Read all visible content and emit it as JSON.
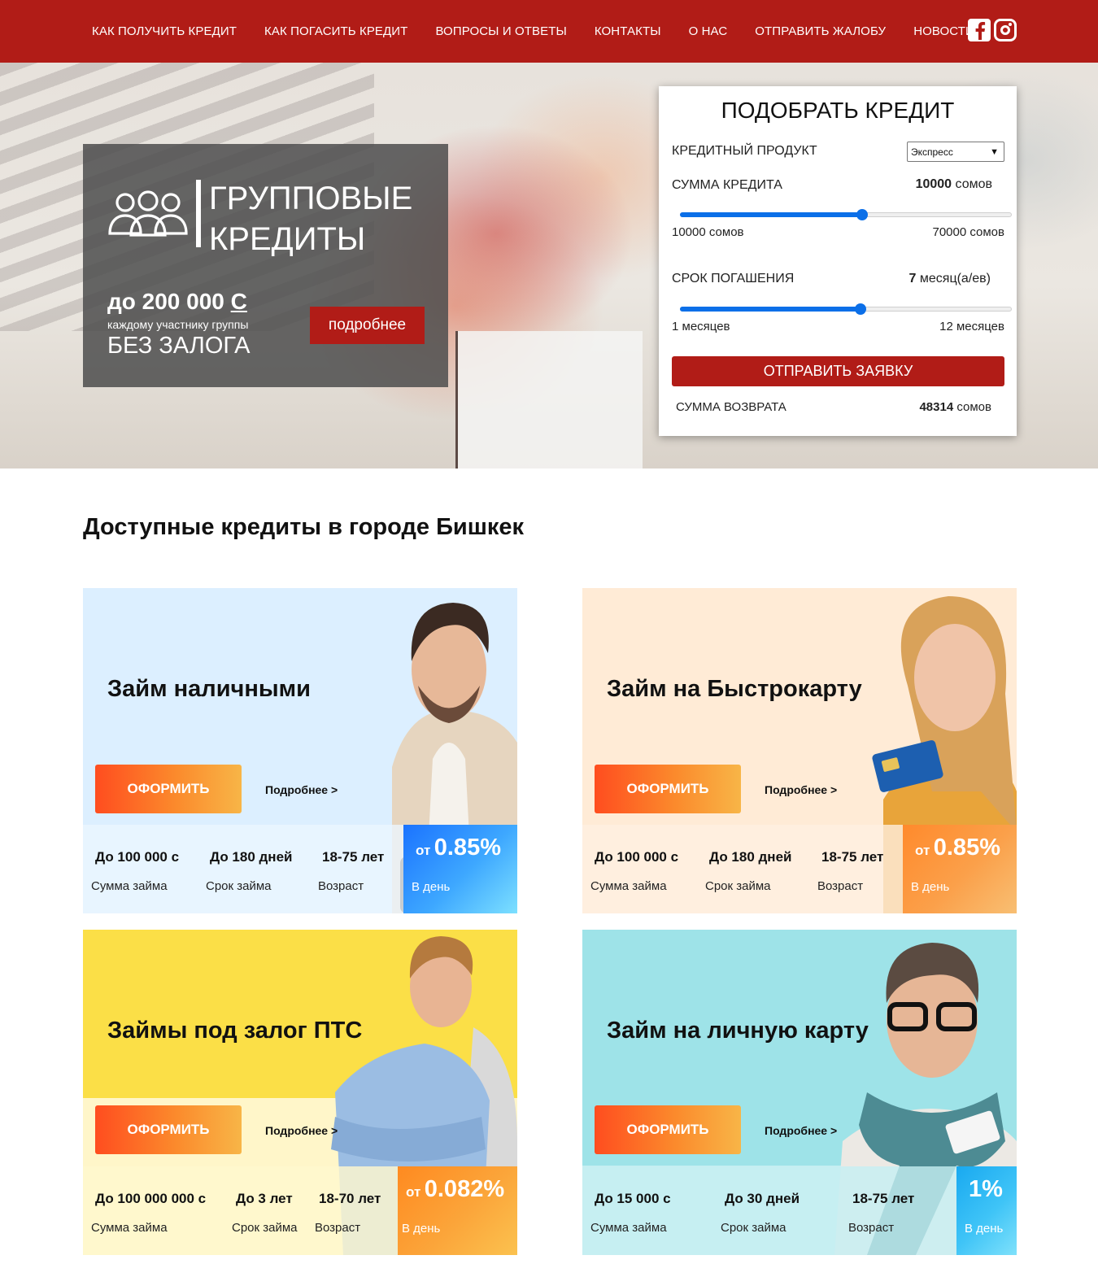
{
  "nav": {
    "items": [
      "КАК ПОЛУЧИТЬ КРЕДИТ",
      "КАК ПОГАСИТЬ КРЕДИТ",
      "ВОПРОСЫ И ОТВЕТЫ",
      "КОНТАКТЫ",
      "О НАС",
      "ОТПРАВИТЬ ЖАЛОБУ",
      "НОВОСТИ"
    ],
    "icons": [
      "facebook-icon",
      "instagram-icon"
    ]
  },
  "promo": {
    "title": "ГРУППОВЫЕ\nКРЕДИТЫ",
    "amount": "до 200 000",
    "currency": "С",
    "subtitle": "каждому участнику группы",
    "no_collateral": "БЕЗ ЗАЛОГА",
    "button": "подробнее"
  },
  "calc": {
    "title": "ПОДОБРАТЬ КРЕДИТ",
    "product_label": "КРЕДИТНЫЙ ПРОДУКТ",
    "product_value": "Экспресс",
    "amount_label": "СУММА КРЕДИТА",
    "amount_value": "10000",
    "amount_unit": "сомов",
    "amount_min": "10000 сомов",
    "amount_max": "70000 сомов",
    "amount_slider_fraction": 0.55,
    "term_label": "СРОК ПОГАШЕНИЯ",
    "term_value": "7",
    "term_unit": "месяц(а/ев)",
    "term_min": "1 месяцев",
    "term_max": "12 месяцев",
    "term_slider_fraction": 0.545,
    "submit": "ОТПРАВИТЬ ЗАЯВКУ",
    "return_label": "СУММА ВОЗВРАТА",
    "return_value": "48314",
    "return_unit": "сомов"
  },
  "section": {
    "title": "Доступные кредиты в городе Бишкек"
  },
  "cards": [
    {
      "title": "Займ наличными",
      "apply": "ОФОРМИТЬ",
      "more": "Подробнее >",
      "stats": [
        {
          "value": "До 100 000 с",
          "label": "Сумма займа"
        },
        {
          "value": "До 180 дней",
          "label": "Срок займа"
        },
        {
          "value": "18-75 лет",
          "label": "Возраст"
        }
      ],
      "rate_from": "от",
      "rate": "0.85%",
      "rate_label": "В день"
    },
    {
      "title": "Займ на Быстрокарту",
      "apply": "ОФОРМИТЬ",
      "more": "Подробнее >",
      "stats": [
        {
          "value": "До 100 000 с",
          "label": "Сумма займа"
        },
        {
          "value": "До 180 дней",
          "label": "Срок займа"
        },
        {
          "value": "18-75 лет",
          "label": "Возраст"
        }
      ],
      "rate_from": "от",
      "rate": "0.85%",
      "rate_label": "В день"
    },
    {
      "title": "Займы под залог ПТС",
      "apply": "ОФОРМИТЬ",
      "more": "Подробнее >",
      "stats": [
        {
          "value": "До 100 000 000 с",
          "label": "Сумма займа"
        },
        {
          "value": "До 3 лет",
          "label": "Срок займа"
        },
        {
          "value": "18-70 лет",
          "label": "Возраст"
        }
      ],
      "rate_from": "от",
      "rate": "0.082%",
      "rate_label": "В день"
    },
    {
      "title": "Займ на личную карту",
      "apply": "ОФОРМИТЬ",
      "more": "Подробнее >",
      "stats": [
        {
          "value": "До 15 000 с",
          "label": "Сумма займа"
        },
        {
          "value": "До 30 дней",
          "label": "Срок займа"
        },
        {
          "value": "18-75 лет",
          "label": "Возраст"
        }
      ],
      "rate_from": "",
      "rate": "1%",
      "rate_label": "В день"
    }
  ],
  "colors": {
    "brand_red": "#b11c17",
    "slider_blue": "#0b6fe8",
    "card1_bg": "#dcefff",
    "card2_bg": "#ffebd6",
    "card3_bg": "#fbdf47",
    "card4_bg": "#9ee3e8"
  }
}
